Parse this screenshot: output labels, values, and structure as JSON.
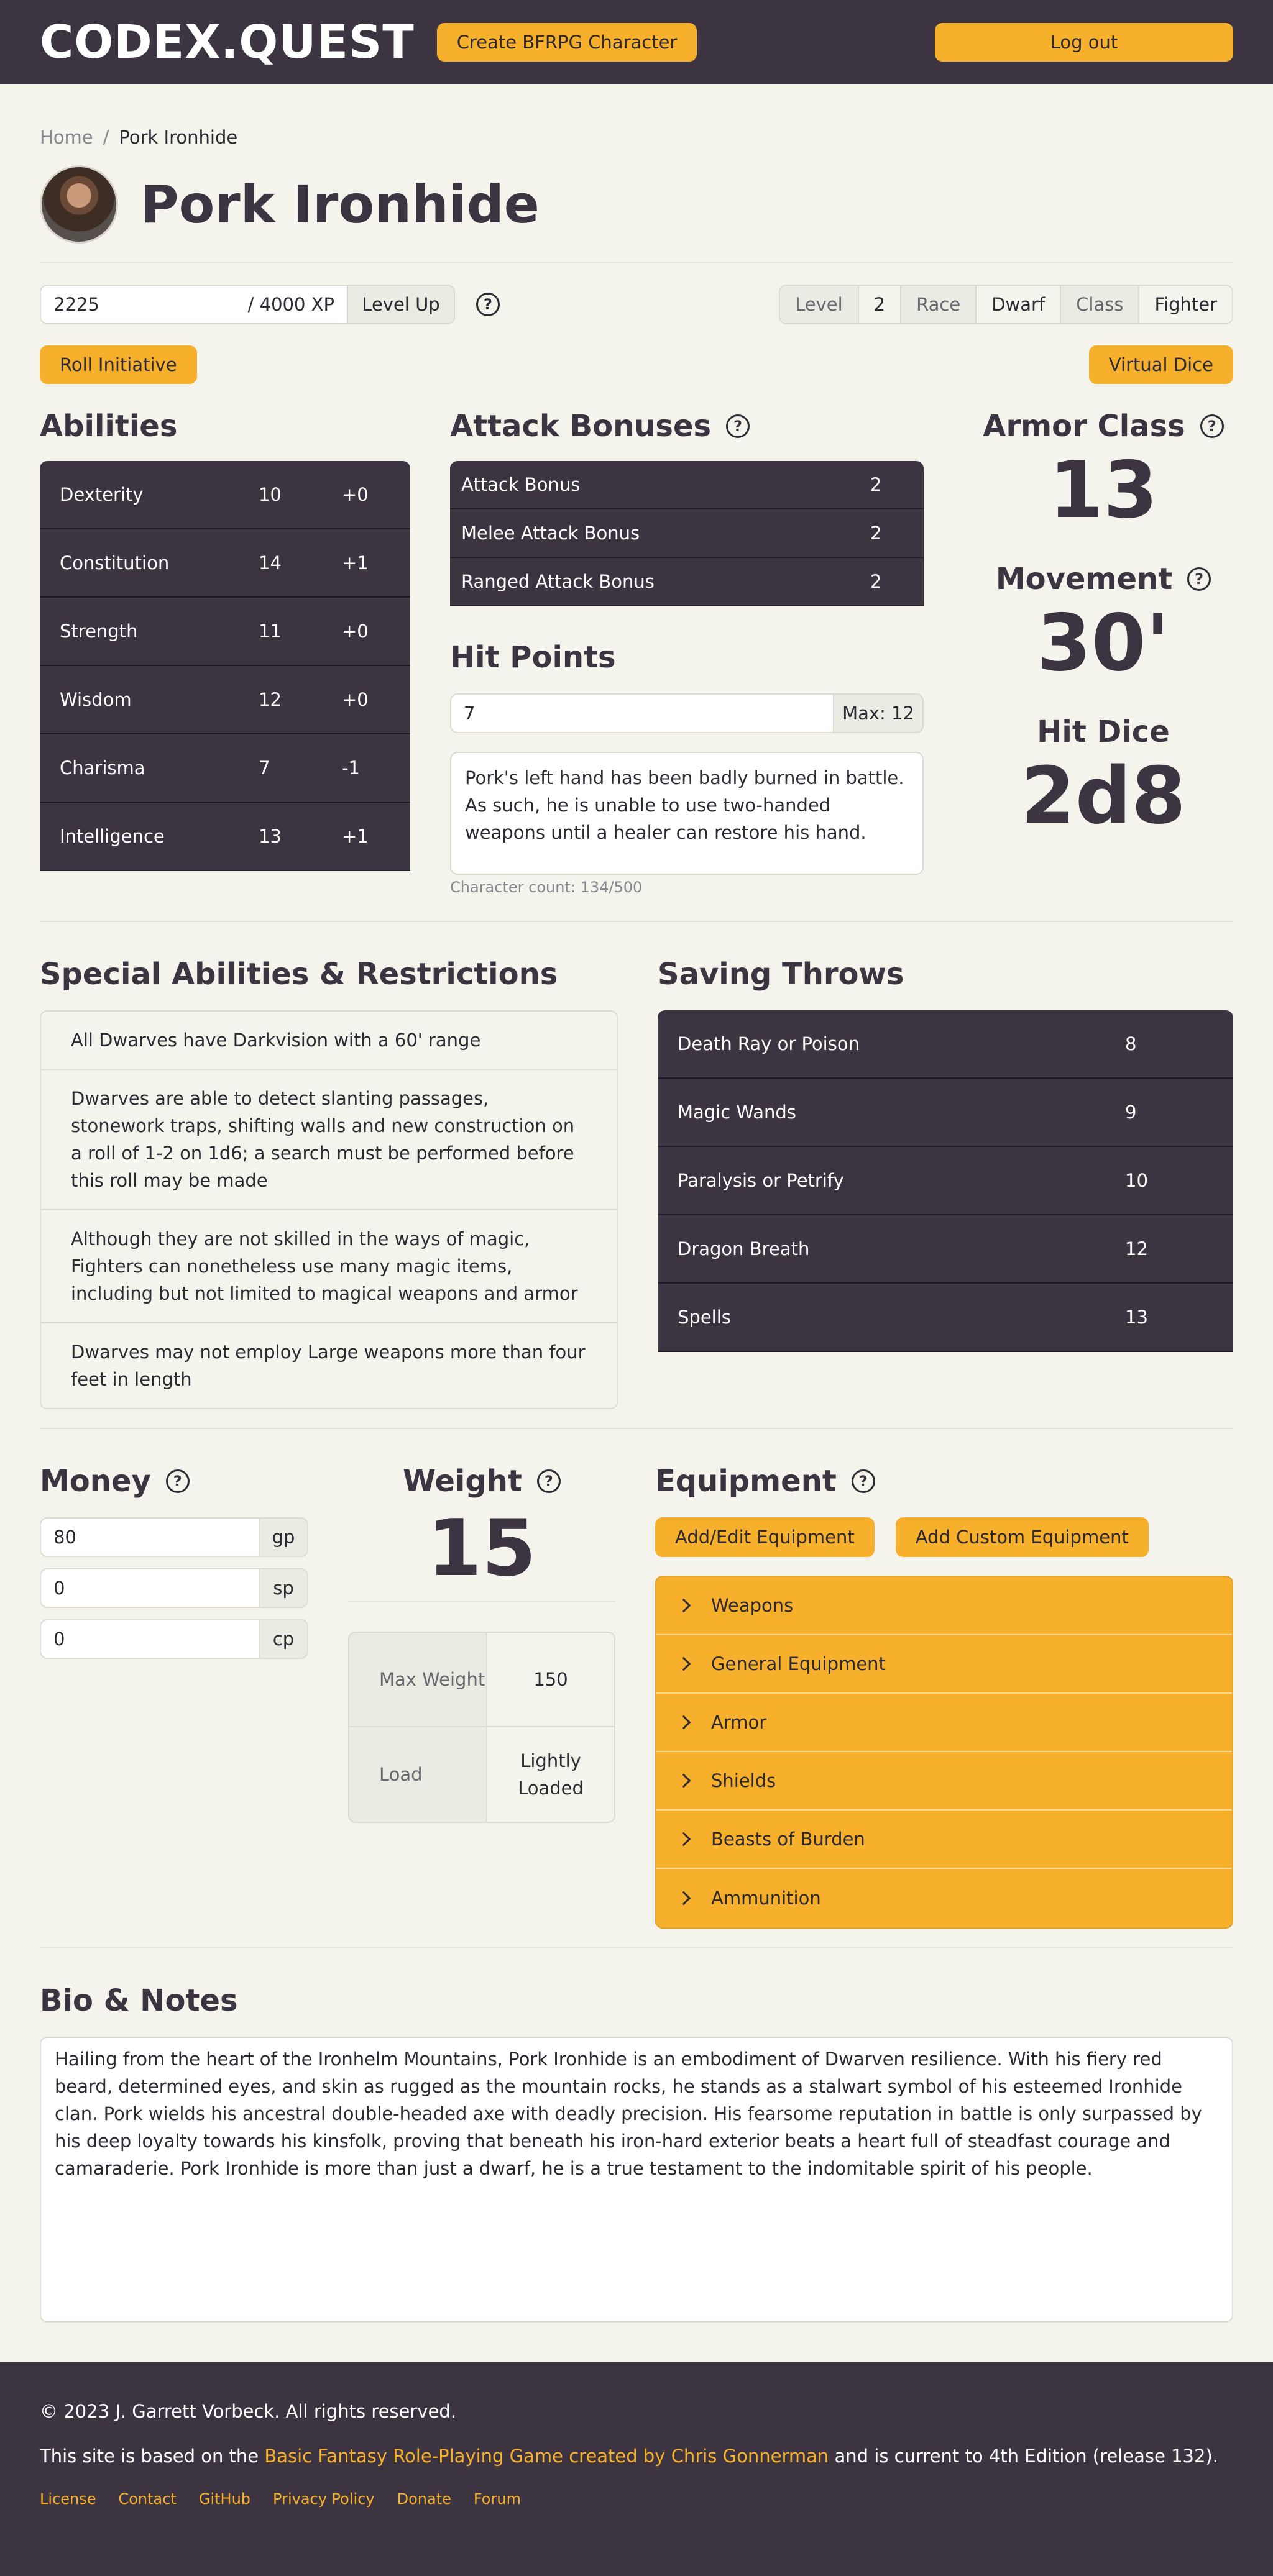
{
  "navbar": {
    "brand": "CODEX.QUEST",
    "create_label": "Create BFRPG Character",
    "logout_label": "Log out"
  },
  "breadcrumb": {
    "home": "Home",
    "separator": "/",
    "current": "Pork Ironhide"
  },
  "character": {
    "name": "Pork Ironhide",
    "xp_value": "2225",
    "xp_max": "/ 4000 XP",
    "level_up_label": "Level Up",
    "info": [
      {
        "label": "Level",
        "value": "2"
      },
      {
        "label": "Race",
        "value": "Dwarf"
      },
      {
        "label": "Class",
        "value": "Fighter"
      }
    ],
    "roll_initiative_label": "Roll Initiative",
    "virtual_dice_label": "Virtual Dice"
  },
  "abilities": {
    "title": "Abilities",
    "rows": [
      {
        "name": "Dexterity",
        "score": "10",
        "mod": "+0"
      },
      {
        "name": "Constitution",
        "score": "14",
        "mod": "+1"
      },
      {
        "name": "Strength",
        "score": "11",
        "mod": "+0"
      },
      {
        "name": "Wisdom",
        "score": "12",
        "mod": "+0"
      },
      {
        "name": "Charisma",
        "score": "7",
        "mod": "-1"
      },
      {
        "name": "Intelligence",
        "score": "13",
        "mod": "+1"
      }
    ]
  },
  "attack": {
    "title": "Attack Bonuses",
    "rows": [
      {
        "name": "Attack Bonus",
        "value": "2"
      },
      {
        "name": "Melee Attack Bonus",
        "value": "2"
      },
      {
        "name": "Ranged Attack Bonus",
        "value": "2"
      }
    ]
  },
  "hit_points": {
    "title": "Hit Points",
    "value": "7",
    "max": "Max: 12",
    "notes": "Pork's left hand has been badly burned in battle. As such, he is unable to use two-handed weapons until a healer can restore his hand.",
    "char_count": "Character count: 134/500"
  },
  "stats": {
    "armor_class_title": "Armor Class",
    "armor_class": "13",
    "movement_title": "Movement",
    "movement": "30'",
    "hit_dice_title": "Hit Dice",
    "hit_dice": "2d8"
  },
  "special": {
    "title": "Special Abilities & Restrictions",
    "items": [
      "All Dwarves have Darkvision with a 60' range",
      "Dwarves are able to detect slanting passages, stonework traps, shifting walls and new construction on a roll of 1-2 on 1d6; a search must be performed before this roll may be made",
      "Although they are not skilled in the ways of magic, Fighters can nonetheless use many magic items, including but not limited to magical weapons and armor",
      "Dwarves may not employ Large weapons more than four feet in length"
    ]
  },
  "saves": {
    "title": "Saving Throws",
    "rows": [
      {
        "name": "Death Ray or Poison",
        "value": "8"
      },
      {
        "name": "Magic Wands",
        "value": "9"
      },
      {
        "name": "Paralysis or Petrify",
        "value": "10"
      },
      {
        "name": "Dragon Breath",
        "value": "12"
      },
      {
        "name": "Spells",
        "value": "13"
      }
    ]
  },
  "money": {
    "title": "Money",
    "rows": [
      {
        "value": "80",
        "unit": "gp"
      },
      {
        "value": "0",
        "unit": "sp"
      },
      {
        "value": "0",
        "unit": "cp"
      }
    ]
  },
  "weight": {
    "title": "Weight",
    "value": "15",
    "max_label": "Max Weight",
    "max_value": "150",
    "load_label": "Load",
    "load_value": "Lightly Loaded"
  },
  "equipment": {
    "title": "Equipment",
    "add_edit_label": "Add/Edit Equipment",
    "add_custom_label": "Add Custom Equipment",
    "categories": [
      "Weapons",
      "General Equipment",
      "Armor",
      "Shields",
      "Beasts of Burden",
      "Ammunition"
    ]
  },
  "bio": {
    "title": "Bio & Notes",
    "text": "Hailing from the heart of the Ironhelm Mountains, Pork Ironhide is an embodiment of Dwarven resilience. With his fiery red beard, determined eyes, and skin as rugged as the mountain rocks, he stands as a stalwart symbol of his esteemed Ironhide clan. Pork wields his ancestral double-headed axe with deadly precision. His fearsome reputation in battle is only surpassed by his deep loyalty towards his kinsfolk, proving that beneath his iron-hard exterior beats a heart full of steadfast courage and camaraderie. Pork Ironhide is more than just a dwarf, he is a true testament to the indomitable spirit of his people."
  },
  "footer": {
    "copyright": "© 2023 J. Garrett Vorbeck. All rights reserved.",
    "based_prefix": "This site is based on the ",
    "based_link": "Basic Fantasy Role-Playing Game created by Chris Gonnerman",
    "based_suffix": " and is current to 4th Edition (release 132).",
    "links": [
      "License",
      "Contact",
      "GitHub",
      "Privacy Policy",
      "Donate",
      "Forum"
    ]
  },
  "help_glyph": "?",
  "colors": {
    "brand_dark": "#3c3541",
    "accent": "#f7b02c",
    "background": "#f4f4ec"
  }
}
